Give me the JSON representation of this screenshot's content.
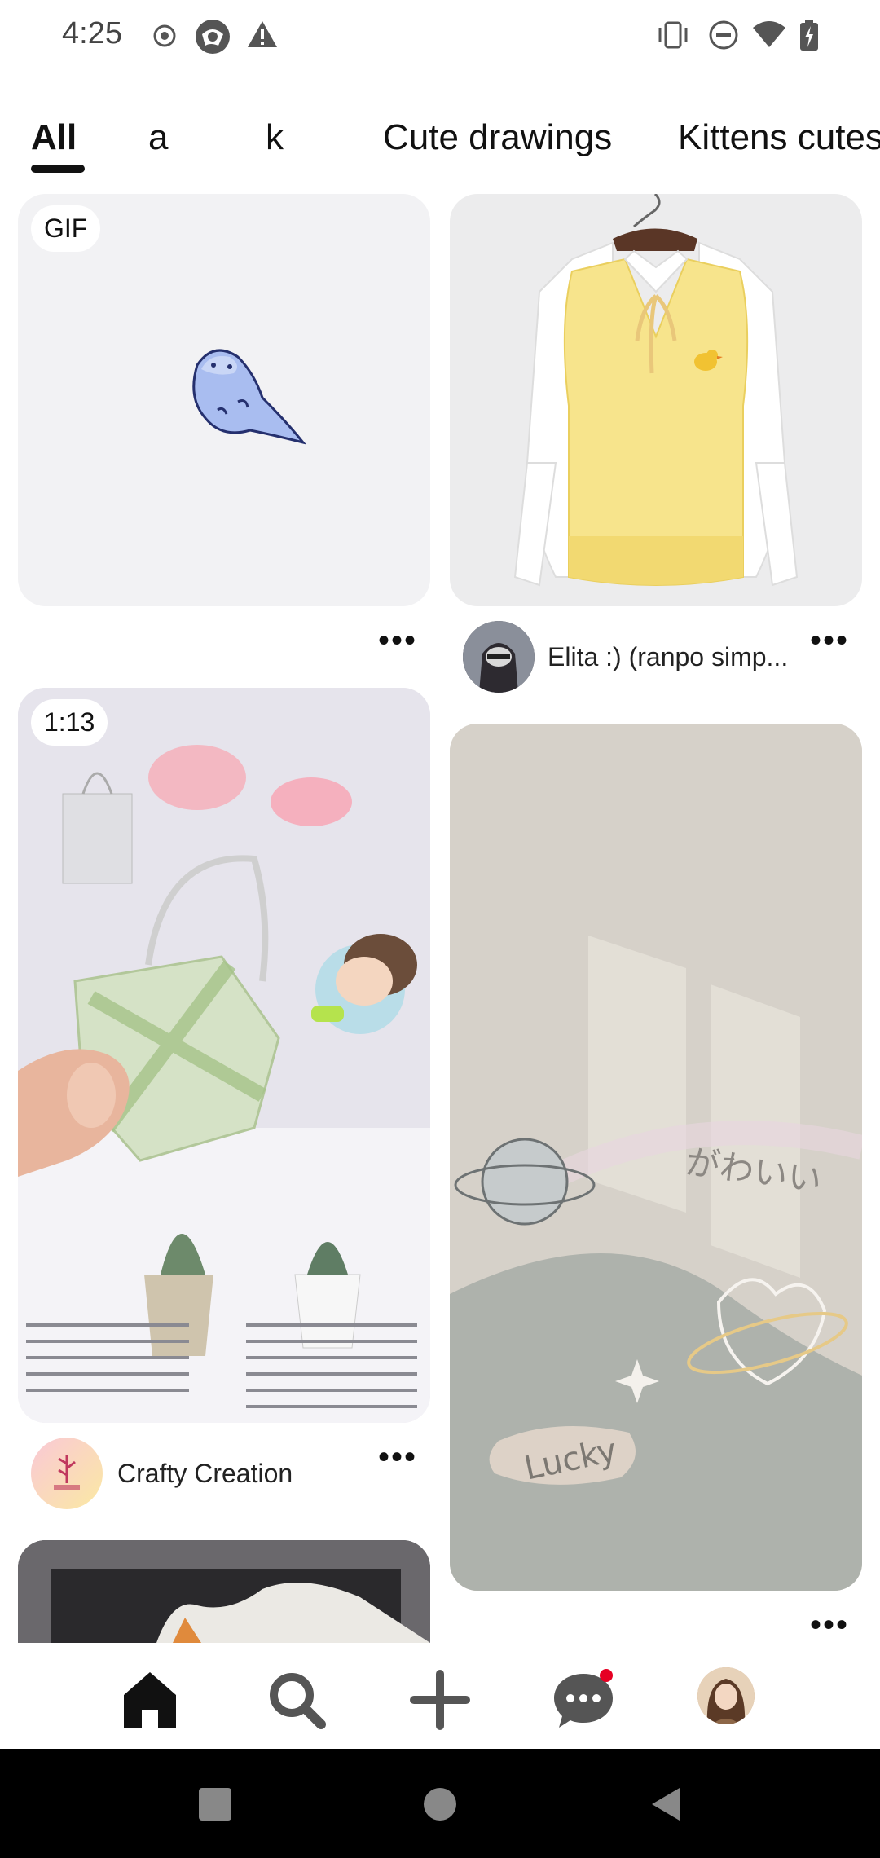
{
  "status_bar": {
    "time": "4:25",
    "icons": [
      "record-icon",
      "app-icon",
      "warning-icon",
      "vibrate-icon",
      "dnd-icon",
      "wifi-icon",
      "battery-charging-icon"
    ]
  },
  "tabs": [
    {
      "label": "All",
      "active": true
    },
    {
      "label": "a"
    },
    {
      "label": "k"
    },
    {
      "label": "Cute drawings"
    },
    {
      "label": "Kittens cutes"
    }
  ],
  "pins": [
    {
      "badge": "GIF",
      "more": "•••"
    },
    {
      "owner": "Elita :) (ranpo simp...",
      "more": "•••"
    },
    {
      "badge": "1:13",
      "owner": "Crafty Creation",
      "more": "•••"
    },
    {
      "more": "•••"
    }
  ],
  "bottom_nav": {
    "items": [
      "home-icon",
      "search-icon",
      "create-icon",
      "messages-icon",
      "profile-avatar"
    ],
    "notification_color": "#e60023"
  },
  "system_nav": [
    "recents-button",
    "home-button",
    "back-button"
  ]
}
